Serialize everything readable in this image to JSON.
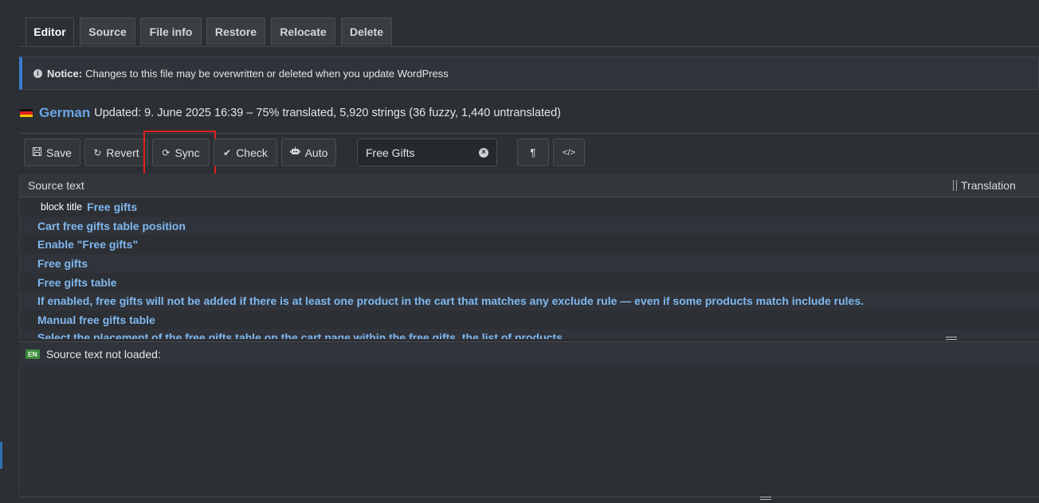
{
  "tabs": [
    "Editor",
    "Source",
    "File info",
    "Restore",
    "Relocate",
    "Delete"
  ],
  "notice": {
    "label": "Notice:",
    "text": "Changes to this file may be overwritten or deleted when you update WordPress"
  },
  "status": {
    "language": "German",
    "summary": "Updated: 9. June 2025 16:39 – 75% translated, 5,920 strings (36 fuzzy, 1,440 untranslated)"
  },
  "toolbar": {
    "save": "Save",
    "revert": "Revert",
    "sync": "Sync",
    "check": "Check",
    "auto": "Auto",
    "filter_value": "Free Gifts",
    "pilcrow": "¶",
    "code": "</>"
  },
  "table": {
    "col_source": "Source text",
    "col_translation": "Translation",
    "rows": [
      {
        "context": "block title",
        "text": "Free gifts"
      },
      {
        "context": "",
        "text": "Cart free gifts table position"
      },
      {
        "context": "",
        "text": "Enable \"Free gifts\""
      },
      {
        "context": "",
        "text": "Free gifts"
      },
      {
        "context": "",
        "text": "Free gifts table"
      },
      {
        "context": "",
        "text": "If enabled, free gifts will not be added if there is at least one product in the cart that matches any exclude rule — even if some products match include rules."
      },
      {
        "context": "",
        "text": "Manual free gifts table"
      },
      {
        "context": "",
        "text": "Select the placement of the free gifts table on the cart page within the free gifts, the list of products"
      }
    ]
  },
  "source_panel": {
    "lang_badge": "EN",
    "label": "Source text not loaded:"
  },
  "colors": {
    "accent_blue": "#3b7bd0",
    "link_blue": "#80b8f0",
    "highlight_red": "#e0201d",
    "background": "#2c2f33"
  }
}
